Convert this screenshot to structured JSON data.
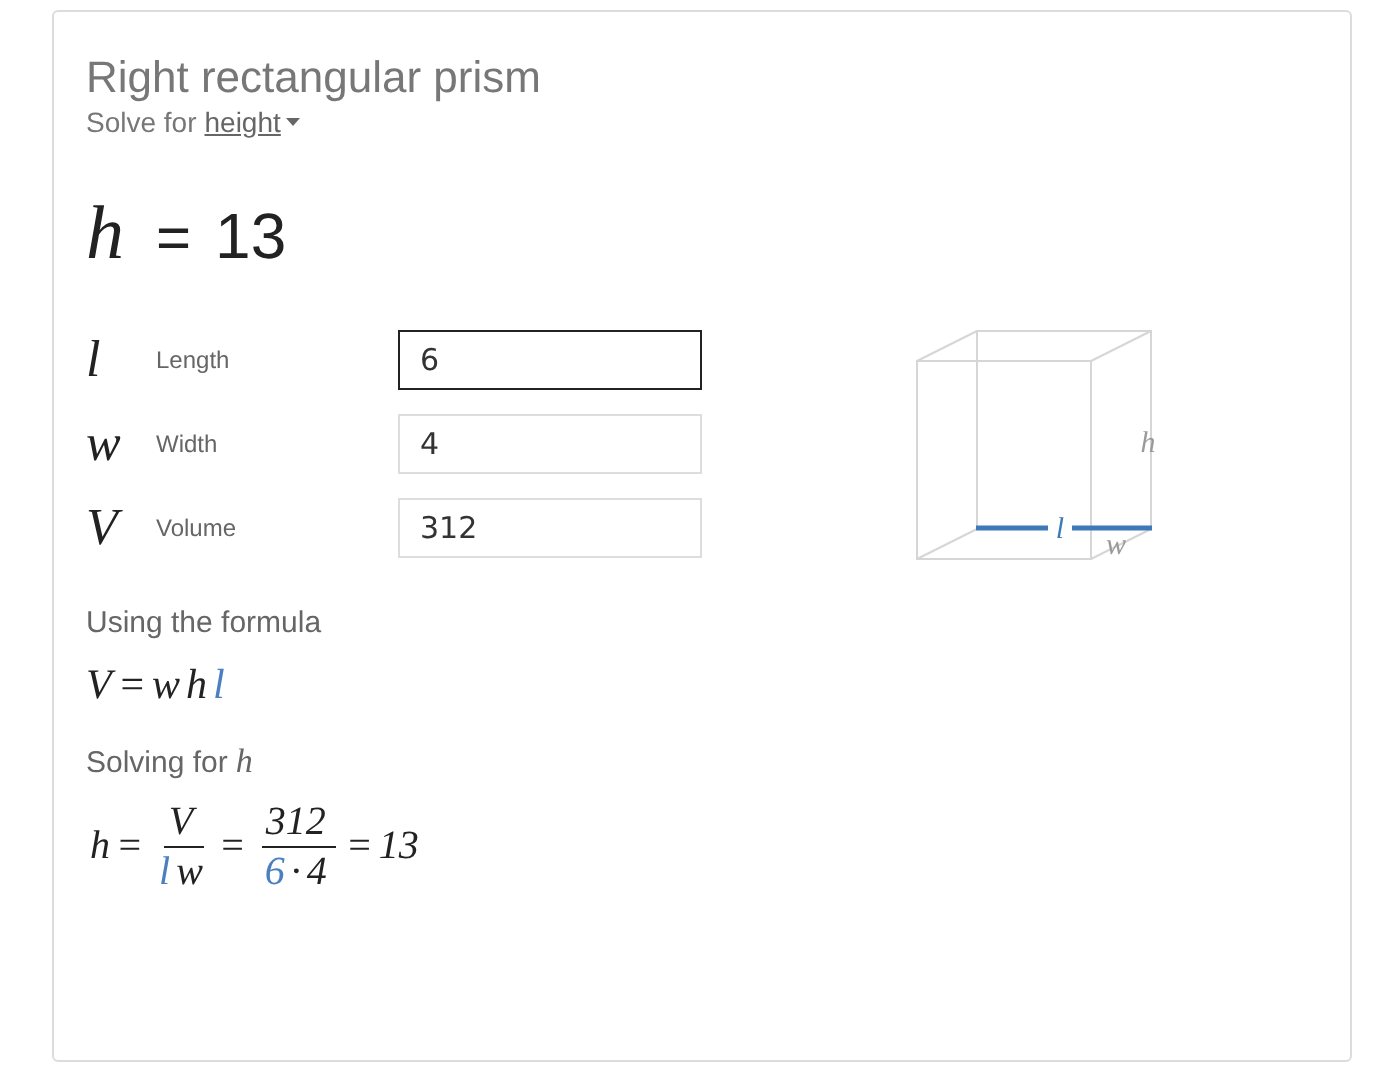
{
  "title": "Right rectangular prism",
  "solve": {
    "label": "Solve for",
    "value": "height"
  },
  "result": {
    "symbol": "h",
    "equals": "=",
    "value": "13"
  },
  "inputs": [
    {
      "symbol": "l",
      "label": "Length",
      "value": "6",
      "focused": true
    },
    {
      "symbol": "w",
      "label": "Width",
      "value": "4",
      "focused": false
    },
    {
      "symbol": "V",
      "label": "Volume",
      "value": "312",
      "focused": false
    }
  ],
  "diagram": {
    "edges": [
      {
        "label": "h",
        "highlighted": false
      },
      {
        "label": "l",
        "highlighted": true
      },
      {
        "label": "w",
        "highlighted": false
      }
    ]
  },
  "formula_heading": "Using the formula",
  "formula": [
    {
      "text": "V",
      "highlighted": false
    },
    {
      "text": "=",
      "highlighted": false
    },
    {
      "text": "w",
      "highlighted": false
    },
    {
      "text": "h",
      "highlighted": false
    },
    {
      "text": "l",
      "highlighted": true
    }
  ],
  "solving_heading": {
    "label": "Solving for",
    "symbol": "h"
  },
  "solution": [
    {
      "kind": "sym",
      "tokens": [
        {
          "text": "h",
          "highlighted": false
        },
        {
          "text": "=",
          "highlighted": false
        }
      ]
    },
    {
      "kind": "frac",
      "num": [
        {
          "text": "V",
          "highlighted": false
        }
      ],
      "den": [
        {
          "text": "l",
          "highlighted": true
        },
        {
          "text": "w",
          "highlighted": false
        }
      ]
    },
    {
      "kind": "sym",
      "tokens": [
        {
          "text": "=",
          "highlighted": false
        }
      ]
    },
    {
      "kind": "frac",
      "num": [
        {
          "text": "312",
          "highlighted": false
        }
      ],
      "den": [
        {
          "text": "6",
          "highlighted": true
        },
        {
          "text": "·",
          "highlighted": false
        },
        {
          "text": "4",
          "highlighted": false
        }
      ]
    },
    {
      "kind": "sym",
      "tokens": [
        {
          "text": "=",
          "highlighted": false
        },
        {
          "text": "13",
          "highlighted": false
        }
      ]
    }
  ]
}
